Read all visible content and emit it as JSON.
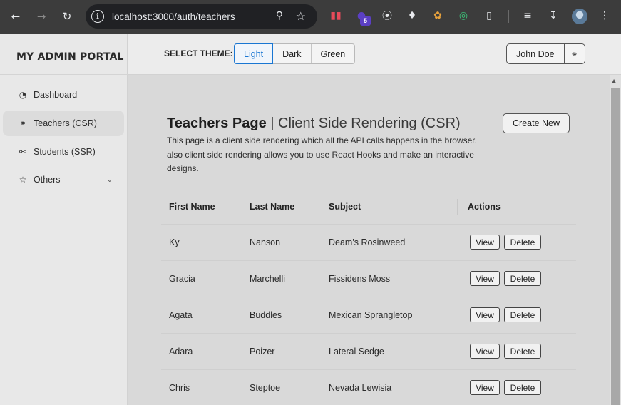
{
  "browser": {
    "url": "localhost:3000/auth/teachers",
    "extension_badge": "5"
  },
  "sidebar": {
    "brand": "MY ADMIN PORTAL",
    "items": [
      {
        "label": "Dashboard",
        "icon": "pie-chart-icon"
      },
      {
        "label": "Teachers (CSR)",
        "icon": "user-icon"
      },
      {
        "label": "Students (SSR)",
        "icon": "users-icon"
      },
      {
        "label": "Others",
        "icon": "star-icon"
      }
    ]
  },
  "header": {
    "theme_label": "SELECT THEME:",
    "themes": [
      "Light",
      "Dark",
      "Green"
    ],
    "selected_theme": "Light",
    "user_name": "John Doe"
  },
  "page": {
    "title_bold": "Teachers Page",
    "title_sep": " | ",
    "title_light": "Client Side Rendering (CSR)",
    "description": "This page is a client side rendering which all the API calls happens in the browser. also client side rendering allows you to use React Hooks and make an interactive designs.",
    "create_label": "Create New"
  },
  "table": {
    "headers": [
      "First Name",
      "Last Name",
      "Subject",
      "Actions"
    ],
    "view_label": "View",
    "delete_label": "Delete",
    "rows": [
      {
        "first": "Ky",
        "last": "Nanson",
        "subject": "Deam's Rosinweed"
      },
      {
        "first": "Gracia",
        "last": "Marchelli",
        "subject": "Fissidens Moss"
      },
      {
        "first": "Agata",
        "last": "Buddles",
        "subject": "Mexican Sprangletop"
      },
      {
        "first": "Adara",
        "last": "Poizer",
        "subject": "Lateral Sedge"
      },
      {
        "first": "Chris",
        "last": "Steptoe",
        "subject": "Nevada Lewisia"
      }
    ]
  }
}
